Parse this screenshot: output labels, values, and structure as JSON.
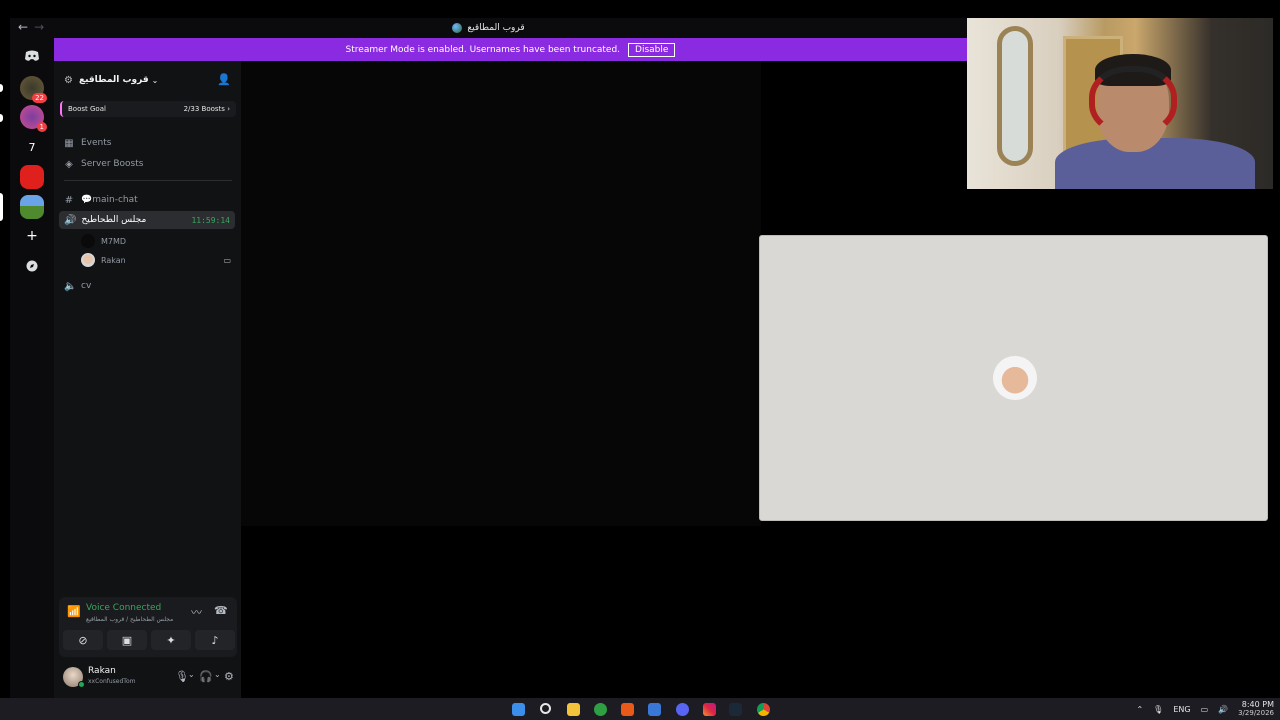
{
  "window": {
    "title": "قروب المطاقيع",
    "nav_back": "←",
    "nav_forward": "→"
  },
  "banner": {
    "message": "Streamer Mode is enabled. Usernames have been truncated.",
    "button": "Disable",
    "color": "#8a2be2"
  },
  "rail": {
    "guilds": [
      {
        "icon": "guild-avatar",
        "badge": "22"
      },
      {
        "icon": "tiktok-like-guild",
        "badge": "1"
      },
      {
        "icon": "text-guild",
        "label": "7"
      },
      {
        "icon": "red-guild"
      },
      {
        "icon": "landscape-guild",
        "active": true
      }
    ],
    "add_server": "+",
    "discover": "compass"
  },
  "server": {
    "name": "قروب المطاقيع",
    "boost_goal_label": "Boost Goal",
    "boost_goal_value": "2/33 Boosts",
    "boost_goal_arrow": "›",
    "nav_items": [
      {
        "label": "Events",
        "icon": "calendar-icon"
      },
      {
        "label": "Server Boosts",
        "icon": "boost-gem-icon"
      }
    ],
    "text_channel": {
      "label": "💬main-chat"
    },
    "voice_channel": {
      "label": "مجلس الطحاطيح",
      "timer": "11:59:14"
    },
    "members": [
      {
        "name": "M7MD"
      },
      {
        "name": "Rakan"
      }
    ],
    "other_voice_channel": {
      "label": "cv"
    }
  },
  "voice_panel": {
    "status": "Voice Connected",
    "location": "مجلس الطحاطيح / قروب المطاقيع",
    "status_color": "#3ba55c"
  },
  "user_panel": {
    "username": "Rakan",
    "custom_status": "xxConfusedTom"
  },
  "tray": {
    "language": "ENG",
    "time": "8:40 PM",
    "date": "3/29/2026"
  }
}
